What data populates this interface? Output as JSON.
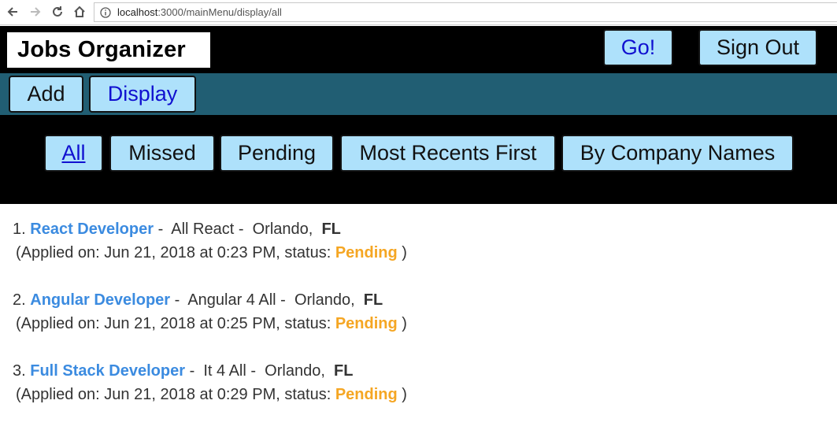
{
  "browser": {
    "url_host": "localhost",
    "url_rest": ":3000/mainMenu/display/all"
  },
  "header": {
    "logo_text": "Jobs Organizer",
    "go_label": "Go!",
    "signout_label": "Sign Out"
  },
  "subnav": {
    "add_label": "Add",
    "display_label": "Display"
  },
  "filters": {
    "all": "All",
    "missed": "Missed",
    "pending": "Pending",
    "recent": "Most Recents First",
    "company": "By Company Names"
  },
  "jobs": [
    {
      "number": "1.",
      "title": "React Developer",
      "company": "All React",
      "city": "Orlando,",
      "state": "FL",
      "applied_prefix": "(Applied on: Jun 21, 2018 at 0:23 PM, status:",
      "status": "Pending",
      "suffix": ")"
    },
    {
      "number": "2.",
      "title": "Angular Developer",
      "company": "Angular 4 All",
      "city": "Orlando,",
      "state": "FL",
      "applied_prefix": "(Applied on: Jun 21, 2018 at 0:25 PM, status:",
      "status": "Pending",
      "suffix": ")"
    },
    {
      "number": "3.",
      "title": "Full Stack Developer",
      "company": "It 4 All",
      "city": "Orlando,",
      "state": "FL",
      "applied_prefix": "(Applied on: Jun 21, 2018 at 0:29 PM, status:",
      "status": "Pending",
      "suffix": ")"
    }
  ],
  "colors": {
    "header_bg": "#000000",
    "subnav_bg": "#215e73",
    "button_bg": "#aee1fb",
    "link_blue": "#3b8be0",
    "status_orange": "#f5a623"
  }
}
